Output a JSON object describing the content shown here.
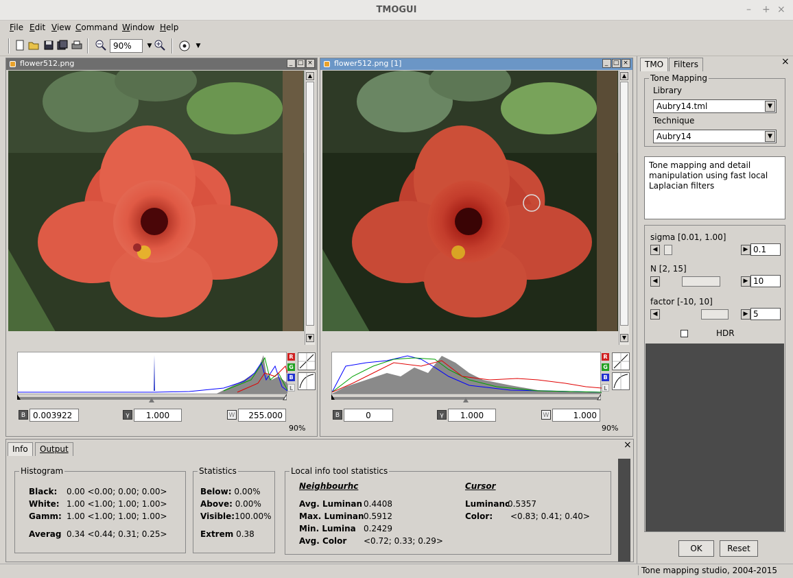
{
  "window": {
    "title": "TMOGUI",
    "controls": [
      "–",
      "+",
      "×"
    ]
  },
  "menu": [
    {
      "label": "File",
      "key": "F",
      "rest": "ile"
    },
    {
      "label": "Edit",
      "key": "E",
      "rest": "dit"
    },
    {
      "label": "View",
      "key": "V",
      "rest": "iew"
    },
    {
      "label": "Command",
      "key": "C",
      "rest": "ommand"
    },
    {
      "label": "Window",
      "key": "W",
      "rest": "indow"
    },
    {
      "label": "Help",
      "key": "H",
      "rest": "elp"
    }
  ],
  "toolbar": {
    "zoom_value": "90%",
    "icons": [
      "new-file-icon",
      "open-folder-icon",
      "save-icon",
      "save-all-icon",
      "print-icon",
      "zoom-out-icon",
      "zoom-in-icon",
      "pointer-tool-icon"
    ]
  },
  "left_window": {
    "title": "flower512.png",
    "black_value": "0.003922",
    "gamma_value": "1.000",
    "white_value": "255.000",
    "zoom_pct": "90%"
  },
  "right_window": {
    "title": "flower512.png [1]",
    "black_value": "0",
    "gamma_value": "1.000",
    "white_value": "1.000",
    "zoom_pct": "90%"
  },
  "channels": {
    "r": "R",
    "g": "G",
    "b": "B",
    "l": "L"
  },
  "info_panel": {
    "tabs": [
      "Info",
      "Output"
    ],
    "histogram": {
      "title": "Histogram",
      "rows": [
        {
          "label": "Black:",
          "value": "0.00 <0.00; 0.00; 0.00>"
        },
        {
          "label": "White:",
          "value": "1.00 <1.00; 1.00; 1.00>"
        },
        {
          "label": "Gamm:",
          "value": "1.00 <1.00; 1.00; 1.00>"
        },
        {
          "label": "Averag",
          "value": "0.34 <0.44; 0.31; 0.25>"
        }
      ]
    },
    "statistics": {
      "title": "Statistics",
      "rows": [
        {
          "label": "Below:",
          "value": "0.00%"
        },
        {
          "label": "Above:",
          "value": "0.00%"
        },
        {
          "label": "Visible:",
          "value": "100.00%"
        },
        {
          "label": "Extrem",
          "value": "0.38"
        }
      ]
    },
    "local": {
      "title": "Local info tool statistics",
      "neighbourhood_header": "Neighbourhc",
      "cursor_header": "Cursor",
      "neigh_rows": [
        {
          "label": "Avg. Luminan",
          "value": "0.4408"
        },
        {
          "label": "Max. Luminan",
          "value": "0.5912"
        },
        {
          "label": "Min. Lumina",
          "value": "0.2429"
        },
        {
          "label": "Avg. Color",
          "value": "<0.72; 0.33; 0.29>"
        }
      ],
      "cursor_rows": [
        {
          "label": "Luminanc",
          "value": "0.5357"
        },
        {
          "label": "Color:",
          "value": "<0.83; 0.41; 0.40>"
        }
      ]
    }
  },
  "right_panel": {
    "tabs": [
      "TMO",
      "Filters"
    ],
    "group_title": "Tone Mapping",
    "library_label": "Library",
    "library_value": "Aubry14.tml",
    "technique_label": "Technique",
    "technique_value": "Aubry14",
    "description": "Tone mapping and detail manipulation using fast local Laplacian filters",
    "params": [
      {
        "label": "sigma [0.01, 1.00]",
        "value": "0.1",
        "level": 0.1
      },
      {
        "label": "N [2, 15]",
        "value": "10",
        "level": 0.62
      },
      {
        "label": "factor [-10, 10]",
        "value": "5",
        "level": 0.75
      }
    ],
    "hdr_label": "HDR",
    "hdr_checked": false,
    "ok_label": "OK",
    "reset_label": "Reset"
  },
  "status": {
    "text": "Tone mapping studio, 2004-2015"
  }
}
